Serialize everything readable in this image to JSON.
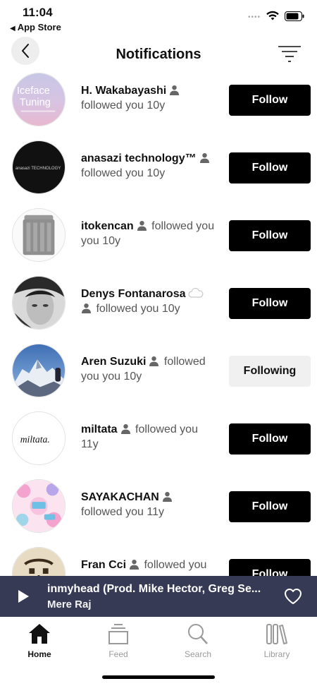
{
  "status_bar": {
    "time": "11:04",
    "back_app": "App Store",
    "back_arrow": "◀"
  },
  "header": {
    "title": "Notifications",
    "back_icon": "chevron-left-icon",
    "filter_icon": "filter-icon"
  },
  "notifications": [
    {
      "username": "H. Wakabayashi",
      "verified": false,
      "action": "followed you",
      "time": "10y",
      "button": "Follow",
      "following": false,
      "avatar": "avatar-iceface"
    },
    {
      "username": "anasazi technology™",
      "verified": false,
      "action": "followed you",
      "time": "10y",
      "button": "Follow",
      "following": false,
      "avatar": "avatar-anasazi"
    },
    {
      "username": "itokencan",
      "verified": false,
      "action": "followed you",
      "time": "10y",
      "button": "Follow",
      "following": false,
      "avatar": "avatar-device"
    },
    {
      "username": "Denys Fontanarosa",
      "verified": true,
      "action": "followed you",
      "time": "10y",
      "button": "Follow",
      "following": false,
      "avatar": "avatar-portrait"
    },
    {
      "username": "Aren Suzuki",
      "verified": false,
      "action": "followed you",
      "time": "10y",
      "button": "Following",
      "following": true,
      "avatar": "avatar-mountain"
    },
    {
      "username": "miltata",
      "verified": false,
      "action": "followed you",
      "time": "11y",
      "button": "Follow",
      "following": false,
      "avatar": "avatar-miltata"
    },
    {
      "username": "SAYAKACHAN",
      "verified": false,
      "action": "followed you",
      "time": "11y",
      "button": "Follow",
      "following": false,
      "avatar": "avatar-pattern"
    },
    {
      "username": "Fran Cci",
      "verified": false,
      "action": "followed you",
      "time": "",
      "button": "Follow",
      "following": false,
      "avatar": "avatar-drawing"
    }
  ],
  "avatar_texts": {
    "iceface_1": "Iceface",
    "iceface_2": "Tuning",
    "anasazi": "anasazi TECHNOLOGY",
    "miltata": "miltata."
  },
  "mini_player": {
    "title": "inmyhead (Prod. Mike Hector, Greg Se...",
    "artist": "Mere Raj",
    "play_icon": "play-icon",
    "like_icon": "heart-icon"
  },
  "tabs": [
    {
      "label": "Home",
      "icon": "home-icon",
      "active": true
    },
    {
      "label": "Feed",
      "icon": "feed-icon",
      "active": false
    },
    {
      "label": "Search",
      "icon": "search-icon",
      "active": false
    },
    {
      "label": "Library",
      "icon": "library-icon",
      "active": false
    }
  ],
  "colors": {
    "follow_bg": "#000000",
    "following_bg": "#f0f0f0",
    "player_bg": "#363a55"
  }
}
